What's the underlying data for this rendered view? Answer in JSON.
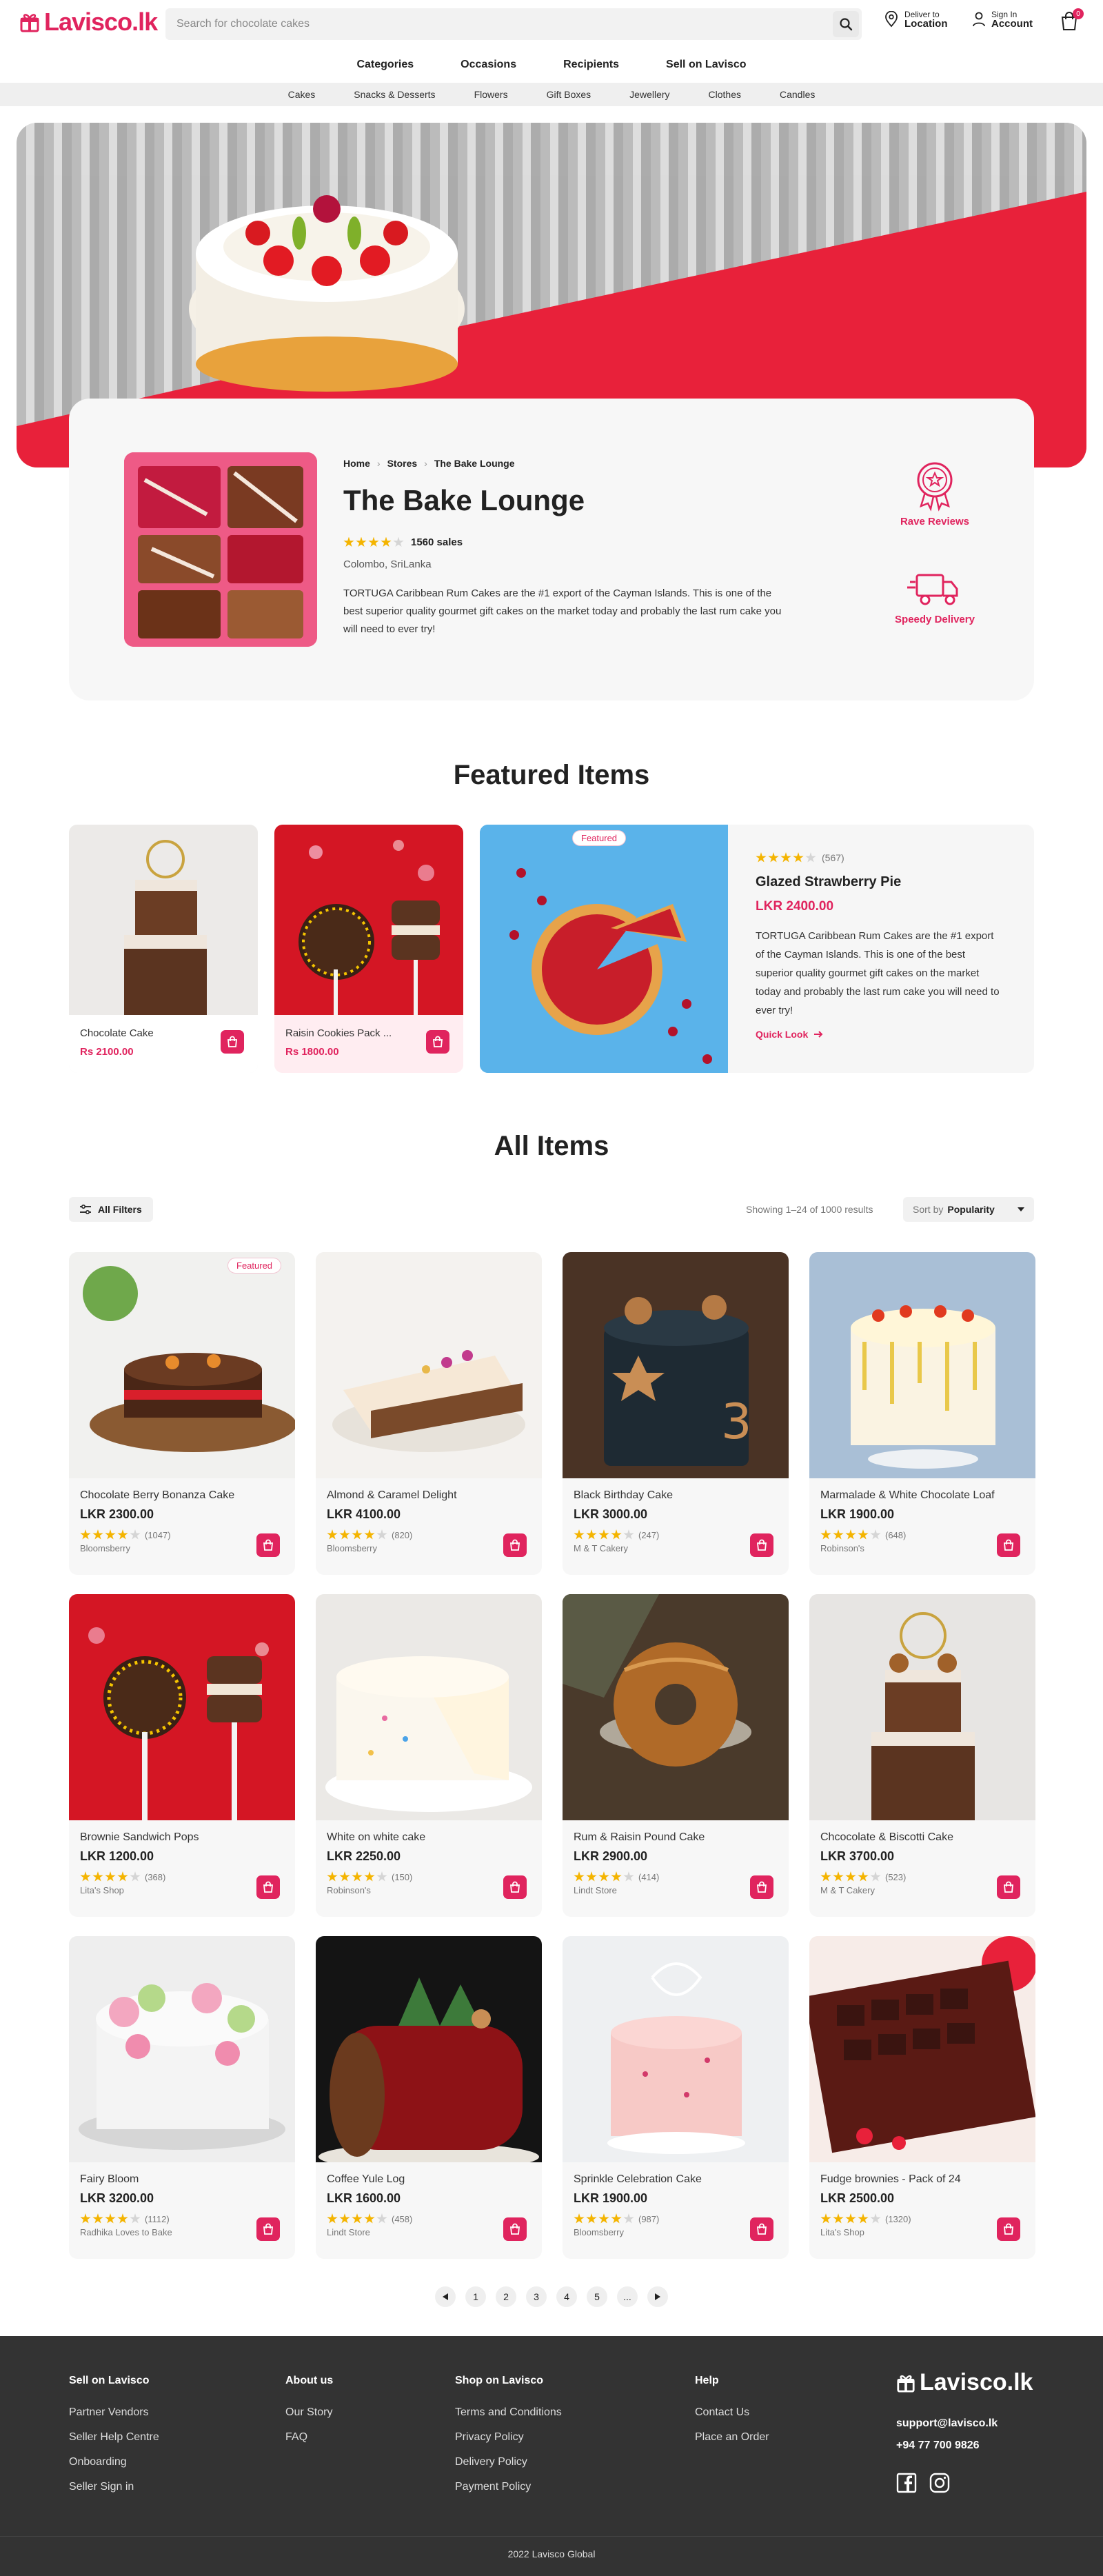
{
  "brand": {
    "name": "Lavisco.lk",
    "accent": "#e0245e"
  },
  "search": {
    "placeholder": "Search for chocolate cakes"
  },
  "header": {
    "location_small": "Deliver to",
    "location_big": "Location",
    "account_small": "Sign In",
    "account_big": "Account",
    "cart_count": "0"
  },
  "nav_primary": [
    "Categories",
    "Occasions",
    "Recipients",
    "Sell on Lavisco"
  ],
  "nav_secondary": [
    "Cakes",
    "Snacks & Desserts",
    "Flowers",
    "Gift Boxes",
    "Jewellery",
    "Clothes",
    "Candles"
  ],
  "store": {
    "breadcrumb": [
      "Home",
      "Stores",
      "The Bake Lounge"
    ],
    "name": "The Bake Lounge",
    "rating": 4,
    "sales": "1560 sales",
    "location": "Colombo, SriLanka",
    "description": "TORTUGA Caribbean Rum Cakes are the #1 export of the Cayman Islands. This is one of the best superior quality gourmet gift cakes on the market today and probably the last rum cake you will need to ever try!",
    "badges": [
      {
        "label": "Rave Reviews",
        "icon": "award-icon"
      },
      {
        "label": "Speedy Delivery",
        "icon": "truck-icon"
      }
    ]
  },
  "featured": {
    "title": "Featured Items",
    "cards": [
      {
        "name": "Chocolate Cake",
        "price": "Rs 2100.00"
      },
      {
        "name": "Raisin Cookies Pack ...",
        "price": "Rs 1800.00"
      }
    ],
    "hero": {
      "tag": "Featured",
      "rating": 4,
      "reviews": "(567)",
      "name": "Glazed Strawberry Pie",
      "price": "LKR 2400.00",
      "description": "TORTUGA Caribbean Rum Cakes are the #1 export of the Cayman Islands. This is one of the best superior quality gourmet gift cakes on the market today and probably the last rum cake you will need to ever try!",
      "link": "Quick Look"
    }
  },
  "all_items": {
    "title": "All Items",
    "filters_label": "All Filters",
    "results": "Showing 1–24 of 1000 results",
    "sort_prefix": "Sort by",
    "sort_value": "Popularity",
    "featured_tag": "Featured",
    "products": [
      {
        "name": "Chocolate Berry Bonanza Cake",
        "price": "LKR 2300.00",
        "rating": 4,
        "reviews": "(1047)",
        "shop": "Bloomsberry"
      },
      {
        "name": "Almond & Caramel Delight",
        "price": "LKR 4100.00",
        "rating": 4,
        "reviews": "(820)",
        "shop": "Bloomsberry"
      },
      {
        "name": "Black Birthday Cake",
        "price": "LKR 3000.00",
        "rating": 4,
        "reviews": "(247)",
        "shop": "M & T Cakery"
      },
      {
        "name": "Marmalade & White Chocolate Loaf",
        "price": "LKR 1900.00",
        "rating": 4,
        "reviews": "(648)",
        "shop": "Robinson's"
      },
      {
        "name": "Brownie Sandwich Pops",
        "price": "LKR 1200.00",
        "rating": 4,
        "reviews": "(368)",
        "shop": "Lita's Shop"
      },
      {
        "name": "White on white cake",
        "price": "LKR 2250.00",
        "rating": 4,
        "reviews": "(150)",
        "shop": "Robinson's"
      },
      {
        "name": "Rum & Raisin Pound Cake",
        "price": "LKR 2900.00",
        "rating": 4,
        "reviews": "(414)",
        "shop": "Lindt Store"
      },
      {
        "name": "Chcocolate & Biscotti Cake",
        "price": "LKR 3700.00",
        "rating": 4,
        "reviews": "(523)",
        "shop": "M & T Cakery"
      },
      {
        "name": "Fairy Bloom",
        "price": "LKR 3200.00",
        "rating": 4,
        "reviews": "(1112)",
        "shop": "Radhika Loves to Bake"
      },
      {
        "name": "Coffee Yule Log",
        "price": "LKR 1600.00",
        "rating": 4,
        "reviews": "(458)",
        "shop": "Lindt Store"
      },
      {
        "name": "Sprinkle Celebration Cake",
        "price": "LKR 1900.00",
        "rating": 4,
        "reviews": "(987)",
        "shop": "Bloomsberry"
      },
      {
        "name": "Fudge brownies - Pack of 24",
        "price": "LKR 2500.00",
        "rating": 4,
        "reviews": "(1320)",
        "shop": "Lita's Shop"
      }
    ],
    "pages": [
      "1",
      "2",
      "3",
      "4",
      "5",
      "..."
    ]
  },
  "footer": {
    "cols": [
      {
        "title": "Sell on Lavisco",
        "links": [
          "Partner Vendors",
          "Seller Help Centre",
          "Onboarding",
          "Seller Sign in"
        ]
      },
      {
        "title": "About us",
        "links": [
          "Our Story",
          "FAQ"
        ]
      },
      {
        "title": "Shop on Lavisco",
        "links": [
          "Terms and Conditions",
          "Privacy Policy",
          "Delivery Policy",
          "Payment Policy"
        ]
      },
      {
        "title": "Help",
        "links": [
          "Contact Us",
          "Place an Order"
        ]
      }
    ],
    "email": "support@lavisco.lk",
    "phone": "+94 77 700 9826",
    "copyright": "2022 Lavisco Global"
  }
}
